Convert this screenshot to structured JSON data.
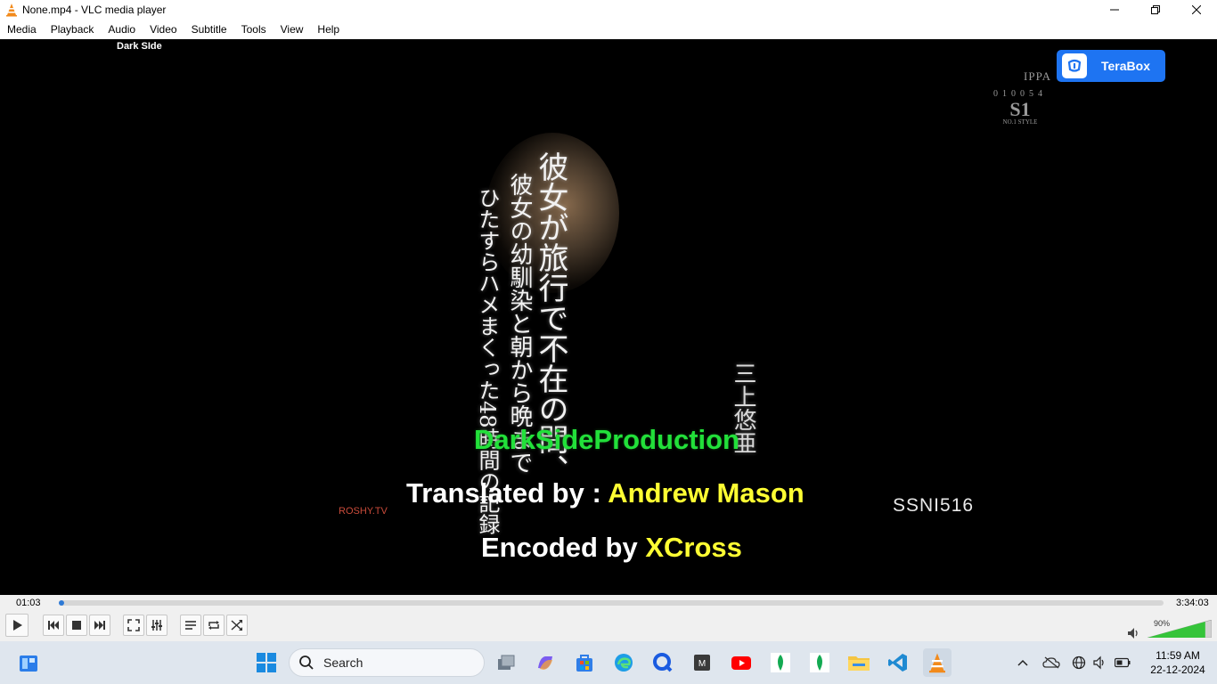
{
  "window": {
    "title": "None.mp4 - VLC media player"
  },
  "menu": [
    "Media",
    "Playback",
    "Audio",
    "Video",
    "Subtitle",
    "Tools",
    "View",
    "Help"
  ],
  "video": {
    "corner_text": "Dark SIde",
    "terabox_label": "TeraBox",
    "logo": {
      "ippa": "IPPA",
      "code": "010054",
      "s1": "S1",
      "style": "NO.1 STYLE"
    },
    "jp_lines": [
      "彼女が旅行で不在の間、",
      "彼女の幼馴染と朝から晩まで",
      "ひたすらハメまくった48時間の記録",
      "三上悠亜"
    ],
    "subtitle_green": "DarkSideProduction",
    "subtitle_line2_prefix": "Translated by : ",
    "subtitle_line2_name": "Andrew Mason",
    "subtitle_line3_prefix": "Encoded by ",
    "subtitle_line3_name": "XCross",
    "roshy": "ROSHY.TV",
    "code": "SSNI516"
  },
  "playback": {
    "time_current": "01:03",
    "time_total": "3:34:03",
    "progress_fraction": 0.005,
    "volume_label": "90%",
    "volume_fraction": 0.9
  },
  "taskbar": {
    "search_placeholder": "Search",
    "time": "11:59 AM",
    "date": "22-12-2024"
  },
  "colors": {
    "accent": "#2e7ad6",
    "sub_yellow": "#ffff33",
    "sub_green": "#22e03a",
    "terabox": "#1e74f2"
  }
}
